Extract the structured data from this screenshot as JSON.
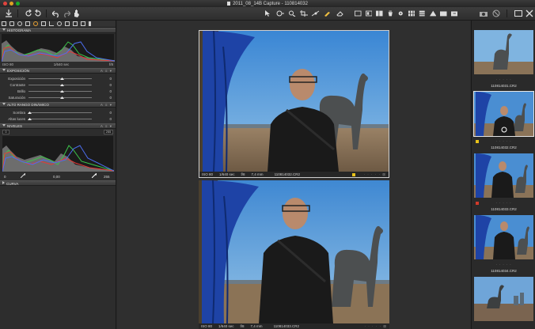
{
  "window": {
    "title": "2011_08_14B Capture - 110814032"
  },
  "left": {
    "sections": {
      "histogram": "HISTOGRAMA",
      "exposure": "EXPOSICIÓN",
      "hdr": "ALTO RANGO DINÁMICO",
      "levels": "NIVELES",
      "curve": "CURVA"
    },
    "histo_info": {
      "iso": "ISO 80",
      "shutter": "1/640 sec",
      "aperture": "f/8"
    },
    "exposure_rows": [
      {
        "label": "Exposición",
        "value": "0"
      },
      {
        "label": "Contraste",
        "value": "0"
      },
      {
        "label": "Brillo",
        "value": "0"
      },
      {
        "label": "Saturación",
        "value": "0"
      }
    ],
    "hdr_rows": [
      {
        "label": "Sombra",
        "value": "0"
      },
      {
        "label": "Altas luces",
        "value": "0"
      }
    ],
    "levels": {
      "top_left": "0",
      "top_right": "255",
      "bottom_left": "0",
      "mid": "0,00",
      "bottom_right": "255"
    }
  },
  "viewer": {
    "top_caption": {
      "iso": "ISO 80",
      "shutter": "1/640 sec",
      "aperture": "f/8",
      "focal": "7,4 mm",
      "file": "110814032.CR2"
    },
    "bottom_caption": {
      "iso": "ISO 80",
      "shutter": "1/640 sec",
      "aperture": "f/8",
      "focal": "7,4 mm",
      "file": "110814033.CR2"
    }
  },
  "filmstrip": [
    {
      "name": "110814031.CR2"
    },
    {
      "name": "110814032.CR2"
    },
    {
      "name": "110814033.CR2"
    },
    {
      "name": "110814034.CR2"
    },
    {
      "name": ""
    }
  ],
  "colors": {
    "accent_orange": "#e8a030",
    "selection": "#e6e6e6",
    "flag_yellow": "#e8c21a",
    "flag_red": "#d23a2a"
  }
}
